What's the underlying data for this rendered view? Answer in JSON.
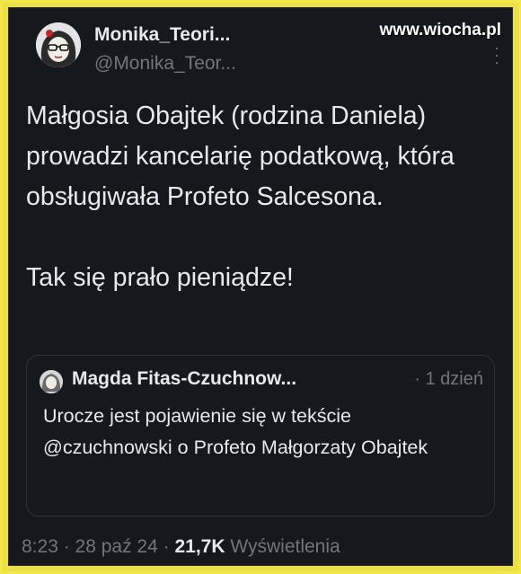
{
  "author": {
    "display_name": "Monika_Teori...",
    "handle": "@Monika_Teor...",
    "avatar_icon": "profile-avatar-icon"
  },
  "watermark": "www.wiocha.pl",
  "more_icon": "more-options-icon",
  "tweet": {
    "paragraph_1": "Małgosia Obajtek (rodzina Daniela) prowadzi kancelarię podatkową, która obsługiwała Profeto Salcesona.",
    "paragraph_2": "Tak się prało pieniądze!"
  },
  "quoted": {
    "name": "Magda Fitas-Czuchnow...",
    "time": "· 1 dzień",
    "text": "Urocze jest pojawienie się w tekście @czuchnowski o Profeto  Małgorzaty Obajtek"
  },
  "footer": {
    "time": "8:23",
    "sep1": " · ",
    "date": "28 paź 24",
    "sep2": " · ",
    "views_count": "21,7K",
    "views_label": " Wyświetlenia"
  },
  "colors": {
    "frame": "#f2e84a",
    "background": "#15181c",
    "text": "#e7e9ea",
    "muted": "#71767b"
  }
}
